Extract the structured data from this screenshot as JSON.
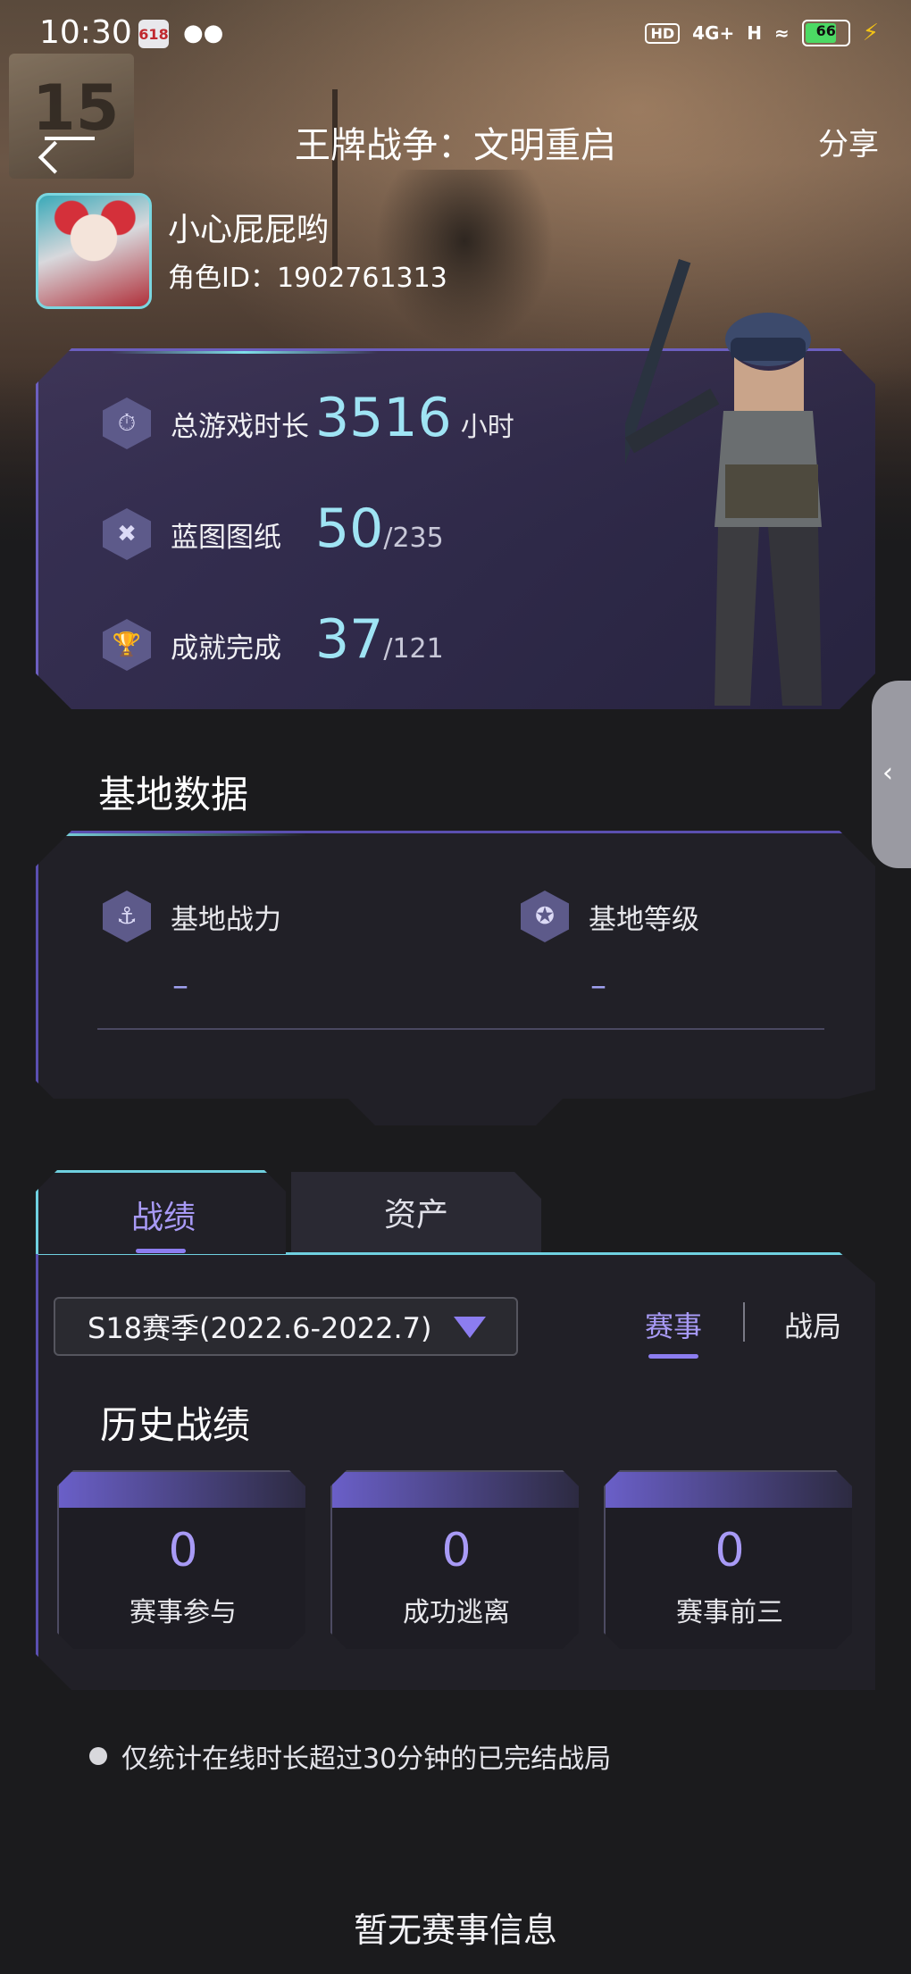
{
  "status_bar": {
    "time": "10:30",
    "app_badge": "618",
    "network_hd": "HD",
    "network_4g": "4G+",
    "network_h": "H",
    "battery": "66"
  },
  "nav": {
    "title": "王牌战争：文明重启",
    "share": "分享"
  },
  "profile": {
    "username": "小心屁屁哟",
    "role_id": "角色ID：1902761313"
  },
  "stats": [
    {
      "label": "总游戏时长",
      "value": "3516",
      "unit": "小时"
    },
    {
      "label": "蓝图图纸",
      "value": "50",
      "denominator": "/235"
    },
    {
      "label": "成就完成",
      "value": "37",
      "denominator": "/121"
    }
  ],
  "base": {
    "title": "基地数据",
    "power_label": "基地战力",
    "power_value": "–",
    "level_label": "基地等级",
    "level_value": "–"
  },
  "tabs": {
    "records": "战绩",
    "assets": "资产"
  },
  "records": {
    "season": "S18赛季(2022.6-2022.7)",
    "filter_events": "赛事",
    "filter_matches": "战局",
    "history_title": "历史战绩",
    "boxes": [
      {
        "value": "0",
        "label": "赛事参与"
      },
      {
        "value": "0",
        "label": "成功逃离"
      },
      {
        "value": "0",
        "label": "赛事前三"
      }
    ]
  },
  "note": "仅统计在线时长超过30分钟的已完结战局",
  "empty_message": "暂无赛事信息",
  "colors": {
    "accent_purple": "#8c7df0",
    "accent_cyan": "#9fe4f4",
    "background": "#1b1b1d"
  }
}
